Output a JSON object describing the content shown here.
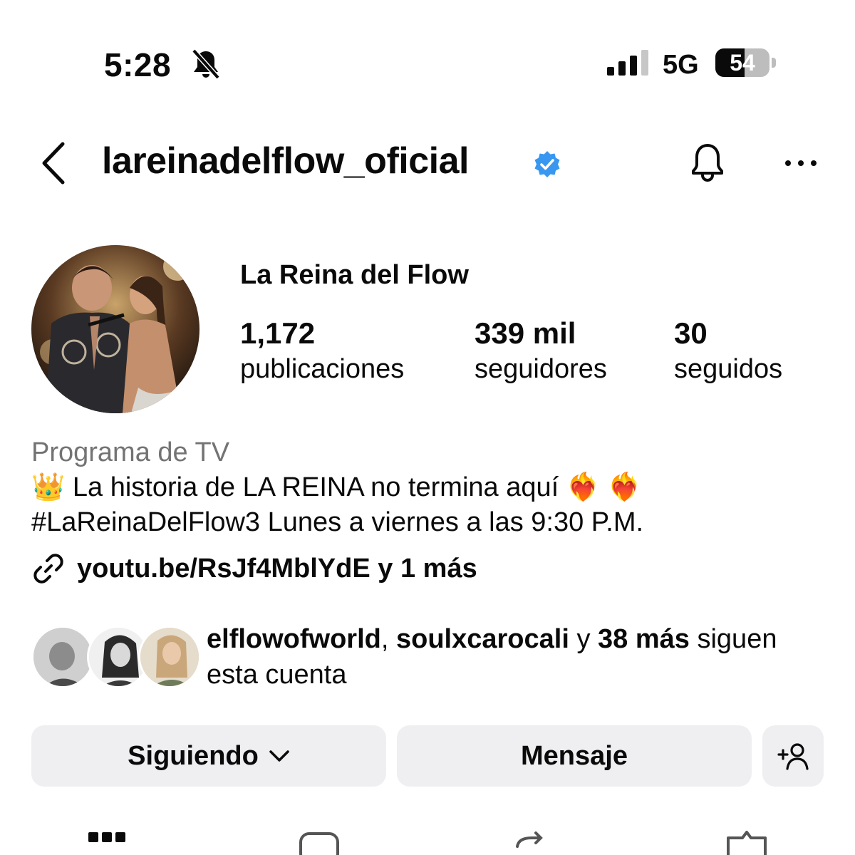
{
  "status_bar": {
    "time": "5:28",
    "network": "5G",
    "battery": "54",
    "battery_level": 0.54,
    "icons": [
      "bell-slash-icon",
      "cellular-signal-icon",
      "battery-icon"
    ]
  },
  "header": {
    "username": "lareinadelflow_oficial",
    "verified": true,
    "icons": [
      "chevron-left-icon",
      "verified-badge-icon",
      "bell-icon",
      "more-horizontal-icon"
    ]
  },
  "profile": {
    "display_name": "La Reina del Flow",
    "stats": [
      {
        "value": "1,172",
        "label": "publicaciones"
      },
      {
        "value": "339 mil",
        "label": "seguidores"
      },
      {
        "value": "30",
        "label": "seguidos"
      }
    ],
    "category": "Programa de TV",
    "bio_line1_prefix": "👑",
    "bio_line1_text": "La historia de LA REINA no termina aquí",
    "bio_line1_suffix": "❤️‍🔥 ❤️‍🔥",
    "bio_line2": "#LaReinaDelFlow3 Lunes a viernes a las 9:30 P.M.",
    "link_text": "youtu.be/RsJf4MblYdE y 1 más"
  },
  "followed_by": {
    "user1": "elflowofworld",
    "separator": ", ",
    "user2": "soulxcarocali",
    "connector": " y ",
    "more": "38 más",
    "suffix": " siguen esta cuenta"
  },
  "actions": {
    "following_label": "Siguiendo",
    "message_label": "Mensaje"
  },
  "tabs": [
    "grid-icon",
    "reels-icon",
    "reposts-icon",
    "tagged-icon"
  ],
  "colors": {
    "verified": "#3897f0",
    "secondary_text": "#737373",
    "button_bg": "#efeff2"
  }
}
